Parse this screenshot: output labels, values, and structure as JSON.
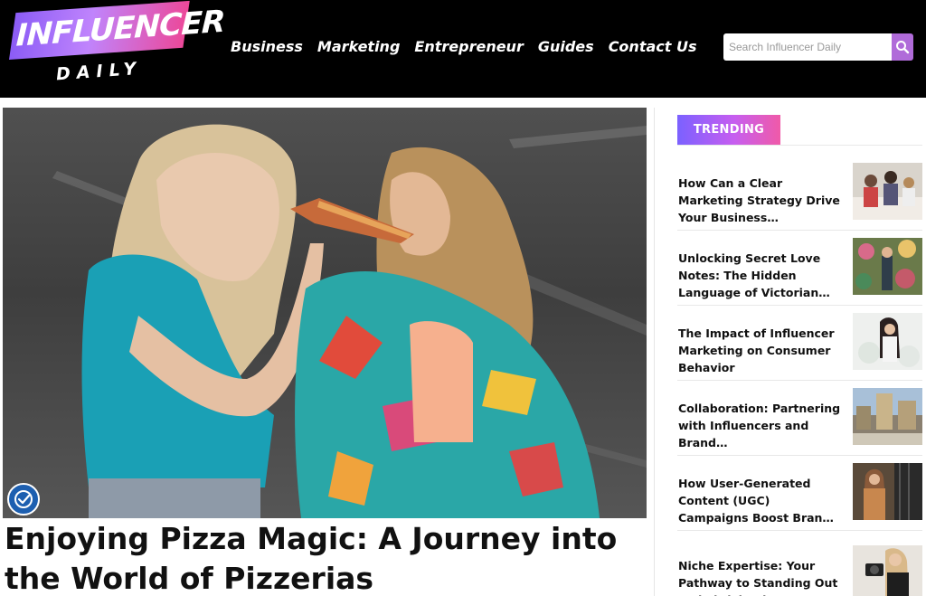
{
  "logo": {
    "main": "INFLUENCER",
    "sub": "DAILY"
  },
  "nav": {
    "items": [
      {
        "label": "Business"
      },
      {
        "label": "Marketing"
      },
      {
        "label": "Entrepreneur"
      },
      {
        "label": "Guides"
      },
      {
        "label": "Contact Us"
      }
    ]
  },
  "search": {
    "placeholder": "Search Influencer Daily",
    "icon": "search-icon"
  },
  "colors": {
    "brand_purple": "#b06bd9",
    "brand_pink": "#ec4899",
    "header_bg": "#000000"
  },
  "hero": {
    "accessibility_icon": "accessibility-icon"
  },
  "article": {
    "headline": "Enjoying Pizza Magic: A Journey into the World of Pizzerias"
  },
  "trending": {
    "label": "TRENDING",
    "items": [
      {
        "title": "How Can a Clear Marketing Strategy Drive Your Business…"
      },
      {
        "title": "Unlocking Secret Love Notes: The Hidden Language of Victorian…"
      },
      {
        "title": "The Impact of Influencer Marketing on Consumer Behavior"
      },
      {
        "title": "Collaboration: Partnering with Influencers and Brand…"
      },
      {
        "title": "How User-Generated Content (UGC) Campaigns Boost Bran…"
      },
      {
        "title": "Niche Expertise: Your Pathway to Standing Out and Thriving in a…"
      }
    ]
  }
}
